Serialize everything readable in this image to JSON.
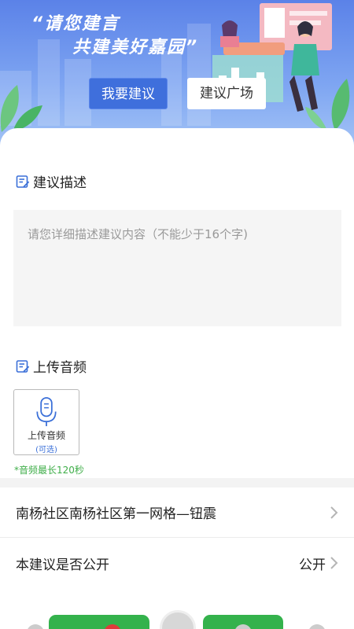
{
  "banner": {
    "slogan_line1": "“请您建言",
    "slogan_line2": "共建美好嘉园”",
    "btn_suggest": "我要建议",
    "btn_square": "建议广场"
  },
  "form": {
    "desc_title": "建议描述",
    "desc_placeholder": "请您详细描述建议内容（不能少于16个字)",
    "audio_title": "上传音频",
    "upload_label": "上传音频",
    "upload_optional": "(可选)",
    "audio_hint": "*音频最长120秒"
  },
  "list": {
    "grid_label": "南杨社区南杨社区第一网格—钮震",
    "public_label": "本建议是否公开",
    "public_value": "公开"
  },
  "colors": {
    "accent": "#3f6fdc",
    "hint_green": "#3fae49",
    "bottom_green": "#34b24c"
  }
}
